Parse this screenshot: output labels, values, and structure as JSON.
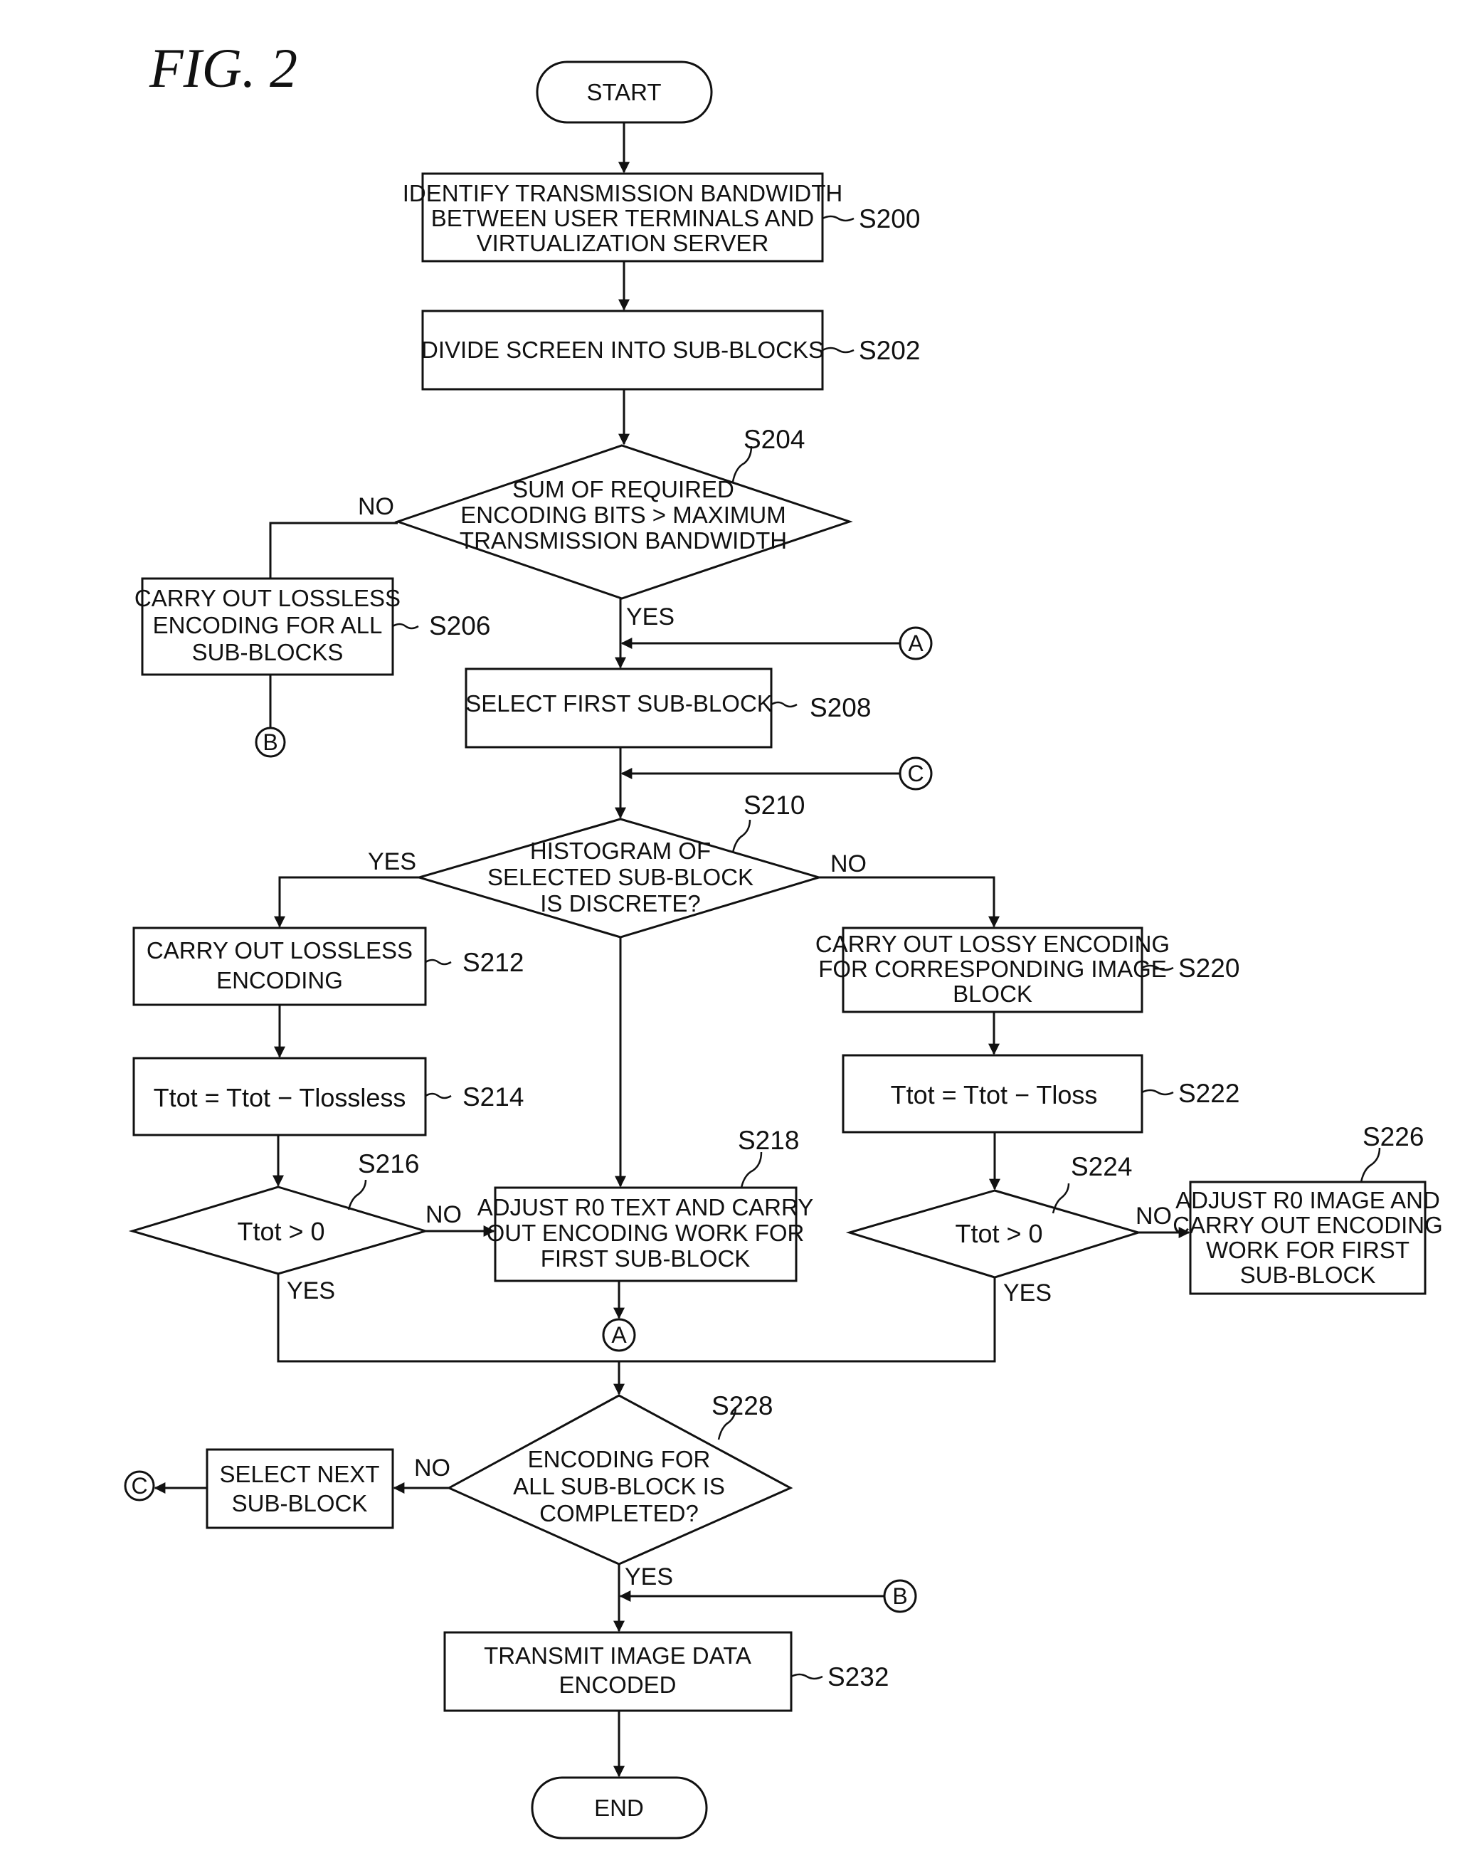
{
  "figure": {
    "title": "FIG. 2"
  },
  "terminals": {
    "start": "START",
    "end": "END"
  },
  "steps": {
    "s200": {
      "id": "S200",
      "lines": [
        "IDENTIFY TRANSMISSION BANDWIDTH",
        "BETWEEN USER TERMINALS AND",
        "VIRTUALIZATION SERVER"
      ]
    },
    "s202": {
      "id": "S202",
      "lines": [
        "DIVIDE SCREEN INTO SUB-BLOCKS"
      ]
    },
    "s204": {
      "id": "S204",
      "lines": [
        "SUM OF REQUIRED",
        "ENCODING BITS > MAXIMUM",
        "TRANSMISSION BANDWIDTH"
      ],
      "yes": "YES",
      "no": "NO"
    },
    "s206": {
      "id": "S206",
      "lines": [
        "CARRY OUT LOSSLESS",
        "ENCODING FOR ALL",
        "SUB-BLOCKS"
      ]
    },
    "s208": {
      "id": "S208",
      "lines": [
        "SELECT FIRST SUB-BLOCK"
      ]
    },
    "s210": {
      "id": "S210",
      "lines": [
        "HISTOGRAM OF",
        "SELECTED SUB-BLOCK",
        "IS DISCRETE?"
      ],
      "yes": "YES",
      "no": "NO"
    },
    "s212": {
      "id": "S212",
      "lines": [
        "CARRY OUT LOSSLESS",
        "ENCODING"
      ]
    },
    "s214": {
      "id": "S214",
      "lines": [
        "Ttot = Ttot − Tlossless"
      ]
    },
    "s216": {
      "id": "S216",
      "lines": [
        "Ttot > 0"
      ],
      "yes": "YES",
      "no": "NO"
    },
    "s218": {
      "id": "S218",
      "lines": [
        "ADJUST R0 TEXT AND CARRY",
        "OUT ENCODING WORK FOR",
        "FIRST SUB-BLOCK"
      ]
    },
    "s220": {
      "id": "S220",
      "lines": [
        "CARRY OUT LOSSY ENCODING",
        "FOR CORRESPONDING IMAGE",
        "BLOCK"
      ]
    },
    "s222": {
      "id": "S222",
      "lines": [
        "Ttot = Ttot − Tloss"
      ]
    },
    "s224": {
      "id": "S224",
      "lines": [
        "Ttot > 0"
      ],
      "yes": "YES",
      "no": "NO"
    },
    "s226": {
      "id": "S226",
      "lines": [
        "ADJUST R0 IMAGE AND",
        "CARRY OUT ENCODING",
        "WORK FOR FIRST",
        "SUB-BLOCK"
      ]
    },
    "s228": {
      "id": "S228",
      "lines": [
        "ENCODING FOR",
        "ALL SUB-BLOCK IS",
        "COMPLETED?"
      ],
      "yes": "YES",
      "no": "NO"
    },
    "s230": {
      "lines": [
        "SELECT NEXT",
        "SUB-BLOCK"
      ]
    },
    "s232": {
      "id": "S232",
      "lines": [
        "TRANSMIT IMAGE DATA",
        "ENCODED"
      ]
    }
  },
  "connectors": {
    "a": "A",
    "b": "B",
    "c": "C"
  }
}
